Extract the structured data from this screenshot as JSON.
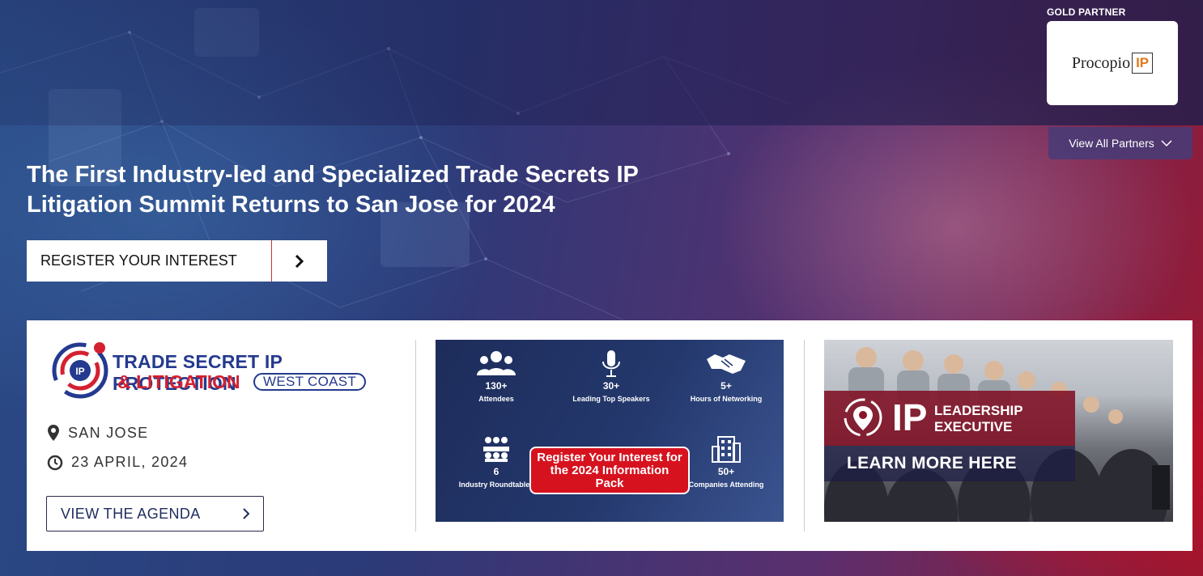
{
  "partner": {
    "label": "GOLD PARTNER",
    "logo_text": "Procopio",
    "logo_mark": "IP",
    "view_all": "View All Partners"
  },
  "hero": {
    "headline": "The First Industry-led and Specialized Trade Secrets IP Litigation Summit Returns to San Jose for 2024",
    "register_label": "REGISTER YOUR INTEREST"
  },
  "event": {
    "logo_line1": "TRADE SECRET IP PROTECTION",
    "logo_line2": "& LITIGATION",
    "logo_badge": "WEST COAST",
    "location": "SAN JOSE",
    "date": "23 APRIL, 2024",
    "agenda_label": "VIEW THE AGENDA"
  },
  "stats_banner": {
    "items": [
      {
        "icon": "people-icon",
        "num": "130+",
        "label": "Attendees"
      },
      {
        "icon": "microphone-icon",
        "num": "30+",
        "label": "Leading Top Speakers"
      },
      {
        "icon": "handshake-icon",
        "num": "5+",
        "label": "Hours of Networking"
      },
      {
        "icon": "roundtable-icon",
        "num": "6",
        "label": "Industry Roundtables"
      },
      {
        "icon": "building-icon",
        "num": "50+",
        "label": "Companies Attending"
      }
    ],
    "cta": "Register Your Interest for the 2024 Information Pack"
  },
  "leadership_banner": {
    "ip": "IP",
    "title_line1": "LEADERSHIP",
    "title_line2": "EXECUTIVE",
    "cta": "LEARN MORE HERE"
  },
  "colors": {
    "navy": "#243a8f",
    "red": "#d42030",
    "text_dark": "#1e2c5e"
  }
}
